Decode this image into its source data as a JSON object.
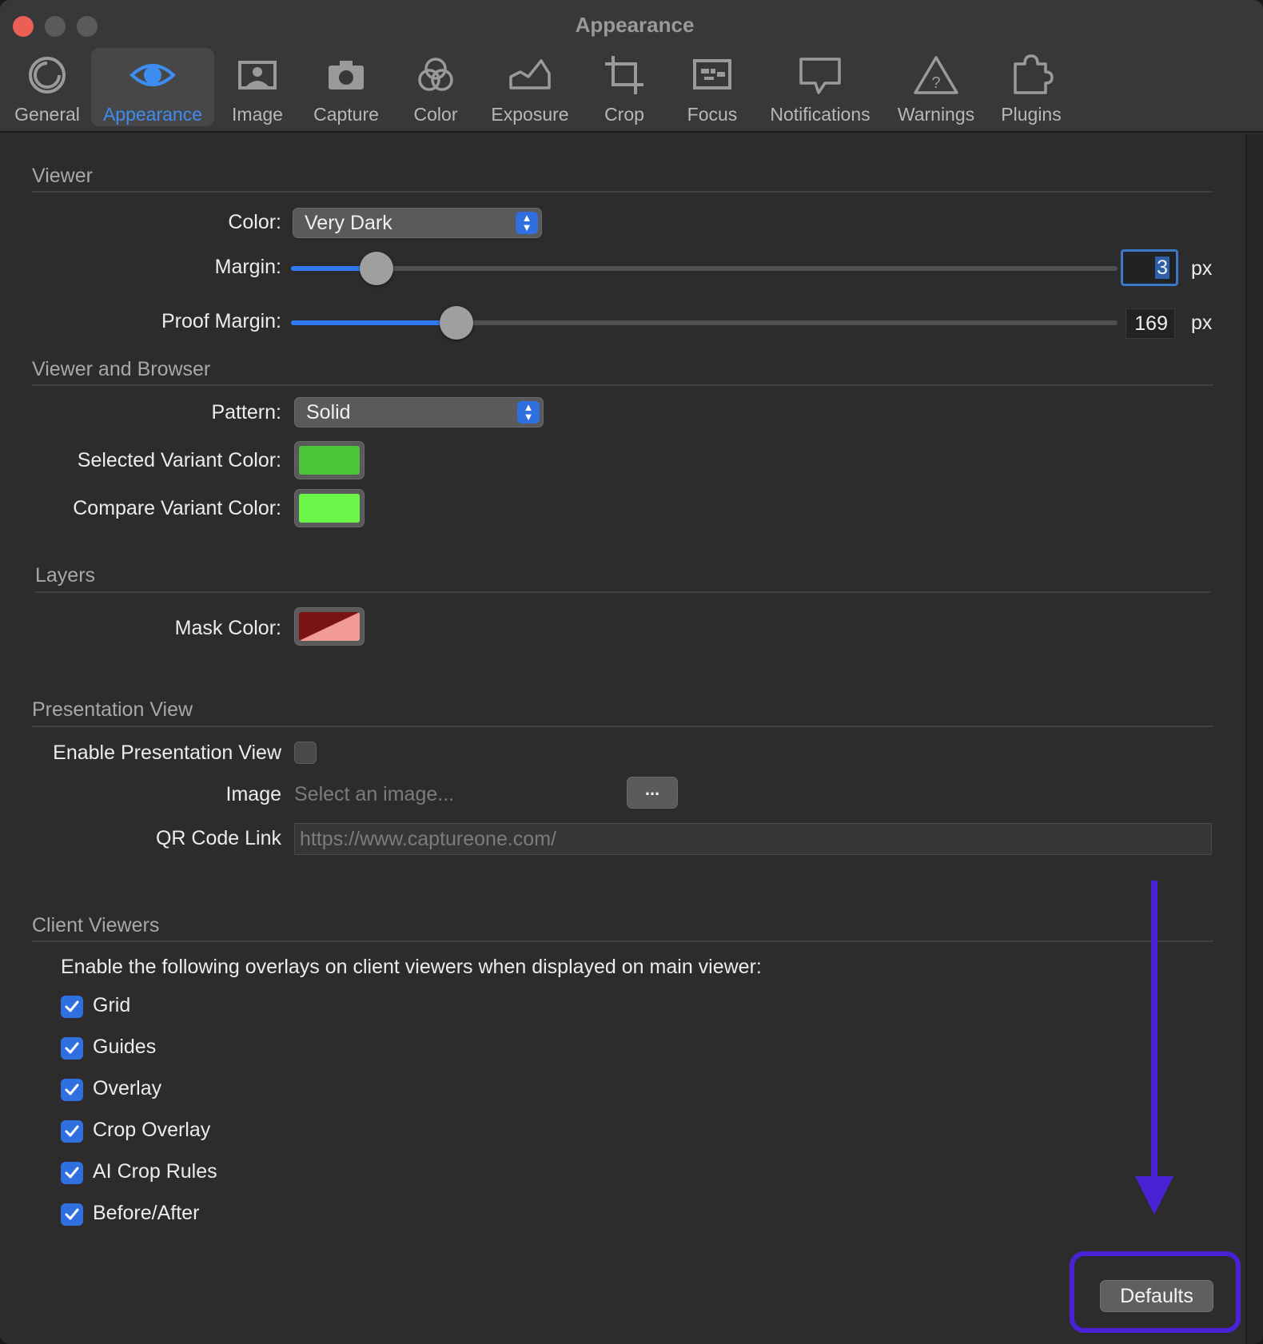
{
  "window": {
    "title": "Appearance"
  },
  "toolbar": {
    "tabs": [
      {
        "label": "General",
        "icon": "general-icon"
      },
      {
        "label": "Appearance",
        "icon": "eye-icon",
        "active": true
      },
      {
        "label": "Image",
        "icon": "image-icon"
      },
      {
        "label": "Capture",
        "icon": "camera-icon"
      },
      {
        "label": "Color",
        "icon": "color-circles-icon"
      },
      {
        "label": "Exposure",
        "icon": "histogram-icon"
      },
      {
        "label": "Crop",
        "icon": "crop-icon"
      },
      {
        "label": "Focus",
        "icon": "focus-icon"
      },
      {
        "label": "Notifications",
        "icon": "speech-bubble-icon"
      },
      {
        "label": "Warnings",
        "icon": "warning-triangle-icon"
      },
      {
        "label": "Plugins",
        "icon": "puzzle-icon"
      }
    ]
  },
  "viewer": {
    "heading": "Viewer",
    "color_label": "Color:",
    "color_value": "Very Dark",
    "margin_label": "Margin:",
    "margin_value": "3",
    "margin_fraction": 0.103,
    "margin_unit": "px",
    "proof_margin_label": "Proof Margin:",
    "proof_margin_value": "169",
    "proof_margin_fraction": 0.2,
    "proof_margin_unit": "px"
  },
  "viewer_browser": {
    "heading": "Viewer and Browser",
    "pattern_label": "Pattern:",
    "pattern_value": "Solid",
    "selected_variant_label": "Selected Variant Color:",
    "selected_variant_color": "#4cc43a",
    "compare_variant_label": "Compare Variant Color:",
    "compare_variant_color": "#6cf54a"
  },
  "layers": {
    "heading": "Layers",
    "mask_label": "Mask Color:",
    "mask_color_dark": "#7a1414",
    "mask_color_light": "#f29a96"
  },
  "presentation": {
    "heading": "Presentation View",
    "enable_label": "Enable Presentation View",
    "enable_checked": false,
    "image_label": "Image",
    "image_placeholder": "Select an image...",
    "browse_label": "...",
    "qr_label": "QR Code Link",
    "qr_placeholder": "https://www.captureone.com/"
  },
  "client_viewers": {
    "heading": "Client Viewers",
    "description": "Enable the following overlays on client viewers when displayed on main viewer:",
    "options": [
      {
        "label": "Grid",
        "checked": true
      },
      {
        "label": "Guides",
        "checked": true
      },
      {
        "label": "Overlay",
        "checked": true
      },
      {
        "label": "Crop Overlay",
        "checked": true
      },
      {
        "label": "AI Crop Rules",
        "checked": true
      },
      {
        "label": "Before/After",
        "checked": true
      }
    ]
  },
  "footer": {
    "defaults_label": "Defaults"
  },
  "colors": {
    "accent": "#2f6fe0",
    "annotation": "#4a22d6"
  }
}
